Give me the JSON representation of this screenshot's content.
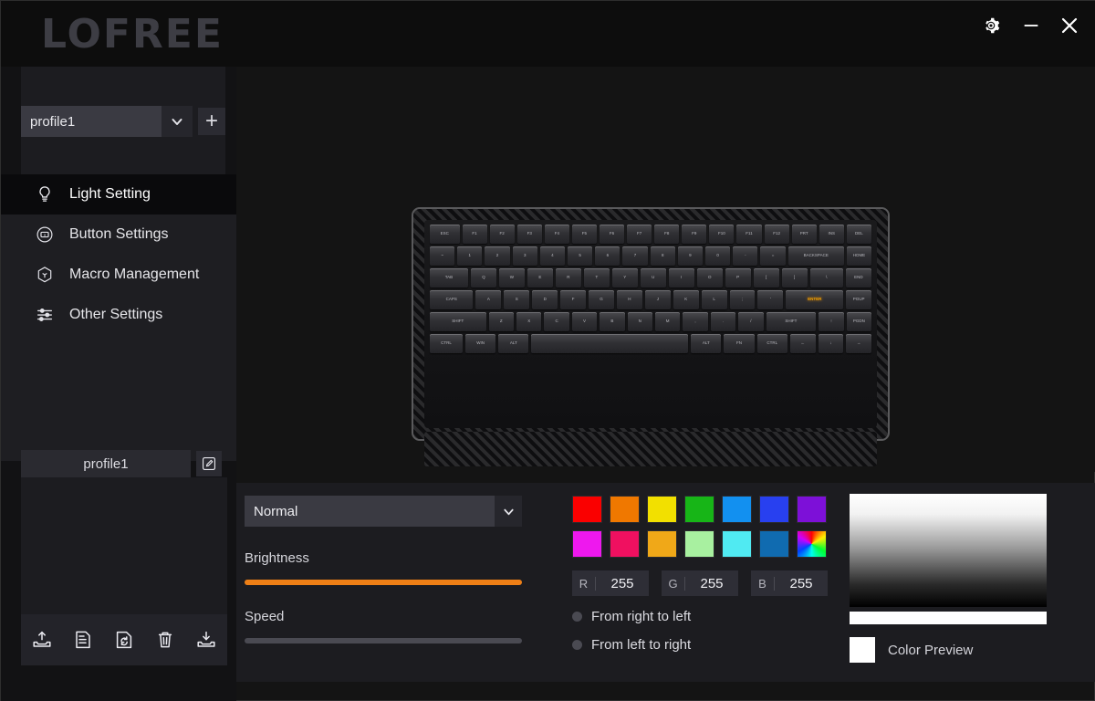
{
  "window": {
    "logo": "LOFREE",
    "controls": [
      {
        "name": "settings-gear",
        "label": "Settings"
      },
      {
        "name": "minimize",
        "label": "Minimize"
      },
      {
        "name": "close",
        "label": "Close"
      }
    ]
  },
  "sidebar": {
    "profile": {
      "selected": "profile1",
      "caret": "chevron-down-icon",
      "add_label": "+"
    },
    "nav": [
      {
        "label": "Light Setting",
        "icon": "bulb-icon",
        "selected": true
      },
      {
        "label": "Button Settings",
        "icon": "key-circle-icon",
        "selected": false
      },
      {
        "label": "Macro Management",
        "icon": "cube-icon",
        "selected": false
      },
      {
        "label": "Other Settings",
        "icon": "sliders-icon",
        "selected": false
      }
    ],
    "profile_name": "profile1",
    "profile_edit_icon": "edit-pencil-icon",
    "toolbar": [
      {
        "name": "export-profile-icon",
        "label": "Export"
      },
      {
        "name": "save-profile-icon",
        "label": "Save"
      },
      {
        "name": "sync-profile-icon",
        "label": "Sync"
      },
      {
        "name": "delete-profile-icon",
        "label": "Delete"
      },
      {
        "name": "import-profile-icon",
        "label": "Import"
      }
    ]
  },
  "keyboard": {
    "lit_key": "ENTER",
    "lit_color": "#f0a000",
    "rows": [
      [
        {
          "t": "ESC",
          "w": "w12"
        },
        {
          "t": "F1"
        },
        {
          "t": "F2"
        },
        {
          "t": "F3"
        },
        {
          "t": "F4"
        },
        {
          "t": "F5"
        },
        {
          "t": "F6"
        },
        {
          "t": "F7"
        },
        {
          "t": "F8"
        },
        {
          "t": "F9"
        },
        {
          "t": "F10"
        },
        {
          "t": "F11"
        },
        {
          "t": "F12"
        },
        {
          "t": "PRT"
        },
        {
          "t": "INS"
        },
        {
          "t": "DEL"
        }
      ],
      [
        {
          "t": "~"
        },
        {
          "t": "1"
        },
        {
          "t": "2"
        },
        {
          "t": "3"
        },
        {
          "t": "4"
        },
        {
          "t": "5"
        },
        {
          "t": "6"
        },
        {
          "t": "7"
        },
        {
          "t": "8"
        },
        {
          "t": "9"
        },
        {
          "t": "0"
        },
        {
          "t": "-"
        },
        {
          "t": "="
        },
        {
          "t": "BACKSPACE",
          "w": "w22"
        },
        {
          "t": "HOME"
        }
      ],
      [
        {
          "t": "TAB",
          "w": "w15"
        },
        {
          "t": "Q"
        },
        {
          "t": "W"
        },
        {
          "t": "E"
        },
        {
          "t": "R"
        },
        {
          "t": "T"
        },
        {
          "t": "Y"
        },
        {
          "t": "U"
        },
        {
          "t": "I"
        },
        {
          "t": "O"
        },
        {
          "t": "P"
        },
        {
          "t": "["
        },
        {
          "t": "]"
        },
        {
          "t": "\\",
          "w": "w13"
        },
        {
          "t": "END"
        }
      ],
      [
        {
          "t": "CAPS",
          "w": "w17"
        },
        {
          "t": "A"
        },
        {
          "t": "S"
        },
        {
          "t": "D"
        },
        {
          "t": "F"
        },
        {
          "t": "G"
        },
        {
          "t": "H"
        },
        {
          "t": "J"
        },
        {
          "t": "K"
        },
        {
          "t": "L"
        },
        {
          "t": ";"
        },
        {
          "t": "'"
        },
        {
          "t": "ENTER",
          "w": "w22",
          "lit": true
        },
        {
          "t": "PGUP"
        }
      ],
      [
        {
          "t": "SHIFT",
          "w": "w22"
        },
        {
          "t": "Z"
        },
        {
          "t": "X"
        },
        {
          "t": "C"
        },
        {
          "t": "V"
        },
        {
          "t": "B"
        },
        {
          "t": "N"
        },
        {
          "t": "M"
        },
        {
          "t": ","
        },
        {
          "t": "."
        },
        {
          "t": "/"
        },
        {
          "t": "SHIFT",
          "w": "w20"
        },
        {
          "t": "↑"
        },
        {
          "t": "PGDN"
        }
      ],
      [
        {
          "t": "CTRL",
          "w": "w13"
        },
        {
          "t": "WIN",
          "w": "w12"
        },
        {
          "t": "ALT",
          "w": "w12"
        },
        {
          "t": "",
          "w": "w60"
        },
        {
          "t": "ALT",
          "w": "w12"
        },
        {
          "t": "FN",
          "w": "w12"
        },
        {
          "t": "CTRL",
          "w": "w12"
        },
        {
          "t": "←"
        },
        {
          "t": "↓"
        },
        {
          "t": "→"
        }
      ]
    ]
  },
  "panel": {
    "effect": {
      "selected": "Normal",
      "caret": "chevron-down-icon"
    },
    "brightness": {
      "label": "Brightness",
      "value": 100,
      "disabled": false
    },
    "speed": {
      "label": "Speed",
      "value": 0,
      "disabled": true
    },
    "swatches": [
      [
        "#fa0000",
        "#f07800",
        "#f2e000",
        "#17b517",
        "#1290f0",
        "#2840f0",
        "#7d10d8"
      ],
      [
        "#ee18ee",
        "#f01060",
        "#f0a818",
        "#a8f0a0",
        "#50eaf2",
        "#106bb0",
        "rainbow"
      ]
    ],
    "rgb": [
      {
        "key": "R",
        "value": "255"
      },
      {
        "key": "G",
        "value": "255"
      },
      {
        "key": "B",
        "value": "255"
      }
    ],
    "directions": [
      {
        "label": "From right to left",
        "selected": false
      },
      {
        "label": "From left to right",
        "selected": false
      }
    ],
    "picker": {
      "preview_label": "Color Preview",
      "preview_color": "#ffffff",
      "hue_color": "#ffffff"
    }
  }
}
